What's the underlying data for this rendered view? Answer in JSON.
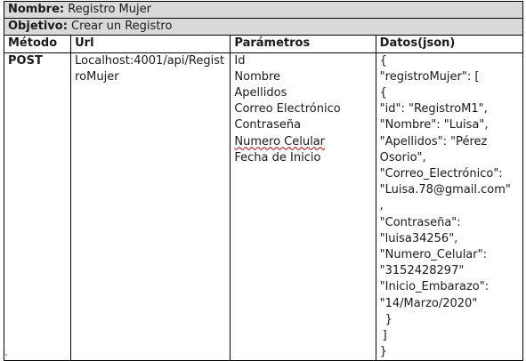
{
  "nombre": {
    "label": "Nombre:",
    "value": "Registro Mujer"
  },
  "objetivo": {
    "label": "Objetivo:",
    "value": "Crear un Registro"
  },
  "headers": {
    "metodo": "Método",
    "url": "Url",
    "parametros": "Parámetros",
    "datos": "Datos(json)"
  },
  "row": {
    "metodo": "POST",
    "url": "Localhost:4001/api/RegistroMujer",
    "parametros": [
      "Id",
      "Nombre",
      "Apellidos",
      "Correo Electrónico",
      "Contraseña",
      "Numero Celular",
      "Fecha de Inicio"
    ],
    "datos": [
      "{",
      "\"registroMujer\": [",
      "{",
      "\"id\": \"RegistroM1\",",
      "\"Nombre\": \"Luisa\",",
      "\"Apellidos\": \"Pérez",
      "Osorio\",",
      "\"Correo_Electrónico\":",
      "\"Luisa.78@gmail.com\"",
      ",",
      "\"Contraseña\":",
      "\"luisa34256\",",
      "\"Numero_Celular\":",
      "\"3152428297\"",
      "\"Inicio_Embarazo\":",
      "\"14/Marzo/2020\"",
      "}",
      "]",
      "}"
    ]
  }
}
